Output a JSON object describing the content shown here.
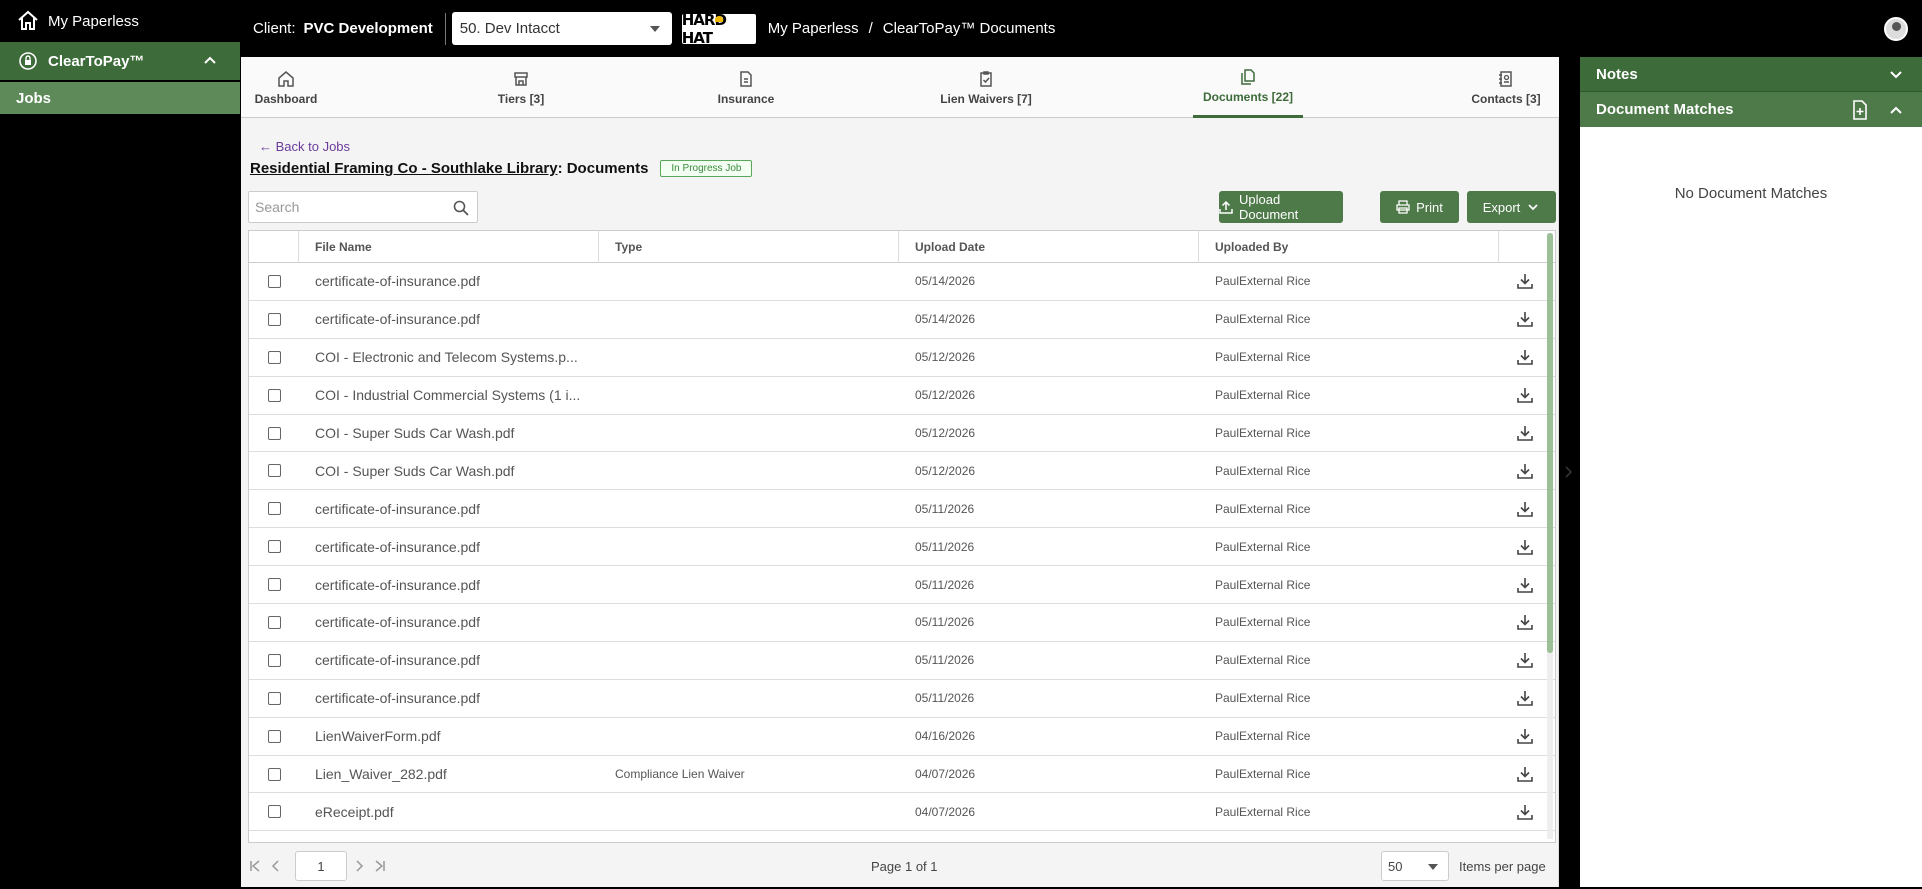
{
  "sidebar": {
    "home_label": "My Paperless",
    "app_label": "ClearToPay™",
    "jobs_label": "Jobs"
  },
  "topbar": {
    "client_label": "Client:",
    "client_name": "PVC Development",
    "client_select_value": "50. Dev Intacct",
    "logo_text": "HARD HAT",
    "breadcrumb": [
      "My Paperless",
      "ClearToPay™ Documents"
    ],
    "breadcrumb_sep": "/"
  },
  "tabs": [
    {
      "label": "Dashboard",
      "icon": "home-icon"
    },
    {
      "label": "Tiers [3]",
      "icon": "store-icon"
    },
    {
      "label": "Insurance",
      "icon": "document-icon"
    },
    {
      "label": "Lien Waivers [7]",
      "icon": "clipboard-check-icon"
    },
    {
      "label": "Documents [22]",
      "icon": "documents-icon",
      "active": true
    },
    {
      "label": "Contacts [3]",
      "icon": "contacts-book-icon"
    }
  ],
  "page": {
    "back_link": "← Back to Jobs",
    "job_name": "Residential Framing Co - Southlake Library",
    "title_suffix": ": Documents",
    "status_badge": "In Progress Job",
    "search_placeholder": "Search"
  },
  "actions": {
    "upload_label": "Upload Document",
    "print_label": "Print",
    "export_label": "Export"
  },
  "table": {
    "columns": [
      "File Name",
      "Type",
      "Upload Date",
      "Uploaded By"
    ],
    "rows": [
      {
        "name": "certificate-of-insurance.pdf",
        "type": "",
        "date": "05/14/2026",
        "by": "PaulExternal Rice"
      },
      {
        "name": "certificate-of-insurance.pdf",
        "type": "",
        "date": "05/14/2026",
        "by": "PaulExternal Rice"
      },
      {
        "name": "COI - Electronic and Telecom Systems.p...",
        "type": "",
        "date": "05/12/2026",
        "by": "PaulExternal Rice"
      },
      {
        "name": "COI - Industrial Commercial Systems (1 i...",
        "type": "",
        "date": "05/12/2026",
        "by": "PaulExternal Rice"
      },
      {
        "name": "COI - Super Suds Car Wash.pdf",
        "type": "",
        "date": "05/12/2026",
        "by": "PaulExternal Rice"
      },
      {
        "name": "COI - Super Suds Car Wash.pdf",
        "type": "",
        "date": "05/12/2026",
        "by": "PaulExternal Rice"
      },
      {
        "name": "certificate-of-insurance.pdf",
        "type": "",
        "date": "05/11/2026",
        "by": "PaulExternal Rice"
      },
      {
        "name": "certificate-of-insurance.pdf",
        "type": "",
        "date": "05/11/2026",
        "by": "PaulExternal Rice"
      },
      {
        "name": "certificate-of-insurance.pdf",
        "type": "",
        "date": "05/11/2026",
        "by": "PaulExternal Rice"
      },
      {
        "name": "certificate-of-insurance.pdf",
        "type": "",
        "date": "05/11/2026",
        "by": "PaulExternal Rice"
      },
      {
        "name": "certificate-of-insurance.pdf",
        "type": "",
        "date": "05/11/2026",
        "by": "PaulExternal Rice"
      },
      {
        "name": "certificate-of-insurance.pdf",
        "type": "",
        "date": "05/11/2026",
        "by": "PaulExternal Rice"
      },
      {
        "name": "LienWaiverForm.pdf",
        "type": "",
        "date": "04/16/2026",
        "by": "PaulExternal Rice"
      },
      {
        "name": "Lien_Waiver_282.pdf",
        "type": "Compliance Lien Waiver",
        "date": "04/07/2026",
        "by": "PaulExternal Rice"
      },
      {
        "name": "eReceipt.pdf",
        "type": "",
        "date": "04/07/2026",
        "by": "PaulExternal Rice"
      }
    ]
  },
  "pager": {
    "page_value": "1",
    "page_label": "Page 1 of 1",
    "page_size": "50",
    "items_per_page": "Items per page"
  },
  "right_panel": {
    "notes_title": "Notes",
    "matches_title": "Document Matches",
    "empty_text": "No Document Matches"
  },
  "colors": {
    "brand_green": "#3d6b3a",
    "button_green": "#4d7a48",
    "link_purple": "#6a3c9c"
  }
}
